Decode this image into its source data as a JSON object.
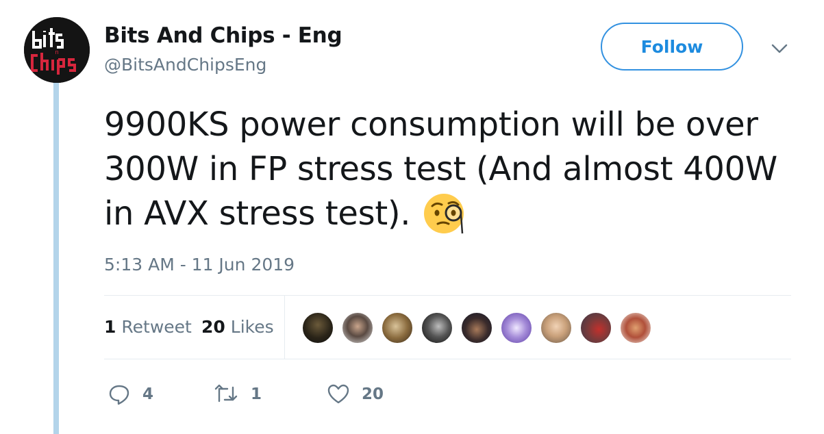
{
  "author": {
    "display_name": "Bits And Chips - Eng",
    "handle": "@BitsAndChipsEng",
    "avatar_icon": "bits-n-chips-logo"
  },
  "follow_button": {
    "label": "Follow"
  },
  "tweet": {
    "text": "9900KS power consumption will be over 300W in FP stress test (And almost 400W in AVX stress test).",
    "emoji": "face-with-monocle",
    "timestamp": "5:13 AM - 11 Jun 2019"
  },
  "stats": {
    "retweets_count": "1",
    "retweets_label": "Retweet",
    "likes_count": "20",
    "likes_label": "Likes"
  },
  "liked_by_avatars": [
    "avatar-1",
    "avatar-2",
    "avatar-3",
    "avatar-4",
    "avatar-5",
    "avatar-6",
    "avatar-7",
    "avatar-8",
    "avatar-9"
  ],
  "actions": {
    "reply_count": "4",
    "retweet_count": "1",
    "like_count": "20"
  },
  "colors": {
    "accent": "#1d8bdf",
    "muted": "#657786",
    "thread_line": "#b3d4ea",
    "logo_red": "#d7263d"
  }
}
